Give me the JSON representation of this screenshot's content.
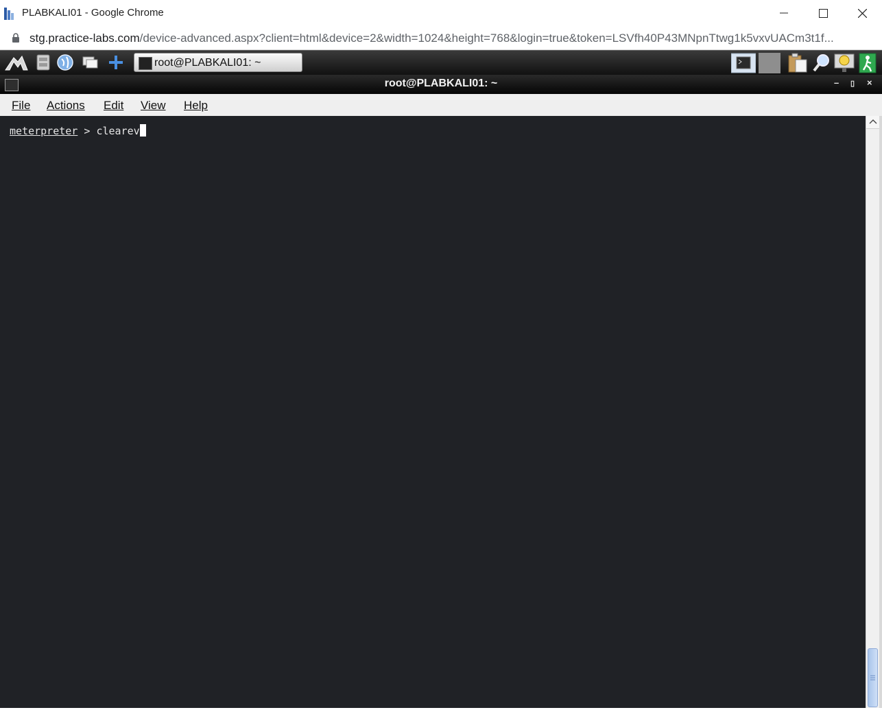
{
  "browser": {
    "window_title": "PLABKALI01 - Google Chrome",
    "url_host": "stg.practice-labs.com",
    "url_path": "/device-advanced.aspx?client=html&device=2&width=1024&height=768&login=true&token=LSVfh40P43MNpnTtwg1k5vxvUACm3t1f..."
  },
  "remote_taskbar": {
    "launcher_icons": [
      "kali-dragon-icon",
      "file-cabinet-icon",
      "globe-icon",
      "windows-icon",
      "add-icon"
    ],
    "active_task_label": "root@PLABKALI01: ~",
    "tray_icons": [
      "terminal-icon",
      "blank-tile-icon",
      "clipboard-icon",
      "search-icon",
      "lightbulb-icon",
      "exit-icon"
    ]
  },
  "terminal": {
    "window_title": "root@PLABKALI01: ~",
    "menu": [
      "File",
      "Actions",
      "Edit",
      "View",
      "Help"
    ],
    "prompt_word": "meterpreter",
    "prompt_symbol": " > ",
    "command": "clearev"
  },
  "colors": {
    "terminal_background": "#202226",
    "terminal_text": "#e6e6e6",
    "scroll_thumb": "#a8c4ea"
  }
}
